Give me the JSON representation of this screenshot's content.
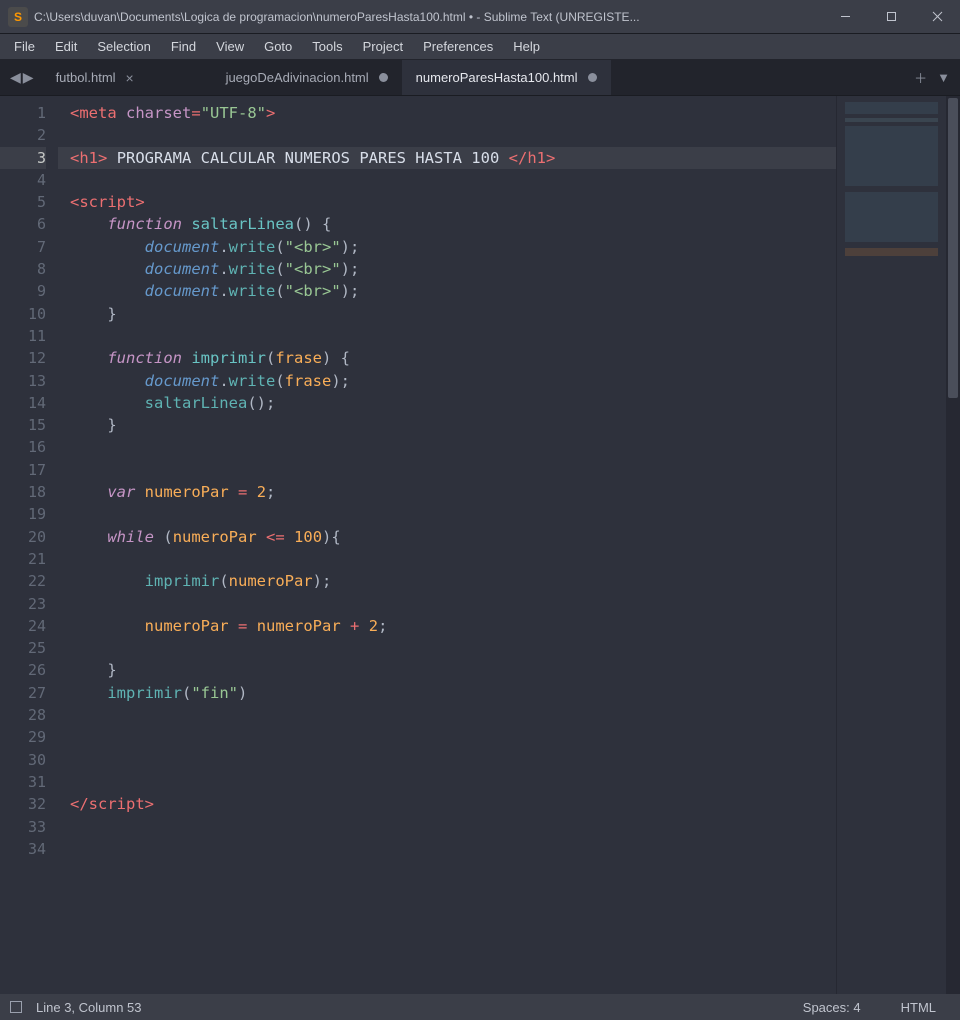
{
  "titlebar": {
    "app_initial": "S",
    "title": "C:\\Users\\duvan\\Documents\\Logica de programacion\\numeroParesHasta100.html • - Sublime Text (UNREGISTE..."
  },
  "menu": [
    "File",
    "Edit",
    "Selection",
    "Find",
    "View",
    "Goto",
    "Tools",
    "Project",
    "Preferences",
    "Help"
  ],
  "tabs": [
    {
      "label": "futbol.html",
      "dirty": false,
      "active": false,
      "closeable": true
    },
    {
      "label": "juegoDeAdivinacion.html",
      "dirty": true,
      "active": false,
      "closeable": false
    },
    {
      "label": "numeroParesHasta100.html",
      "dirty": true,
      "active": true,
      "closeable": false
    }
  ],
  "code": {
    "lines": [
      {
        "n": 1,
        "mod": false,
        "html": "<span class='c-tag'>&lt;</span><span class='c-tagname'>meta</span> <span class='c-attr'>charset</span><span class='c-op'>=</span><span class='c-str'>\"UTF-8\"</span><span class='c-tag'>&gt;</span>"
      },
      {
        "n": 2,
        "mod": false,
        "html": ""
      },
      {
        "n": 3,
        "mod": true,
        "cur": true,
        "html": "<span class='c-tag'>&lt;</span><span class='c-tagname'>h1</span><span class='c-tag'>&gt;</span><span class='c-text'> PROGRAMA CALCULAR NUMEROS PARES HASTA 100 </span><span class='c-tag'>&lt;/</span><span class='c-tagname'>h1</span><span class='c-tag'>&gt;</span>"
      },
      {
        "n": 4,
        "mod": false,
        "html": ""
      },
      {
        "n": 5,
        "mod": false,
        "html": "<span class='c-tag'>&lt;</span><span class='c-tagname'>script</span><span class='c-tag'>&gt;</span>"
      },
      {
        "n": 6,
        "mod": false,
        "html": "    <span class='c-storage'>function</span> <span class='c-fn'>saltarLinea</span><span class='c-punc'>() {</span>"
      },
      {
        "n": 7,
        "mod": false,
        "html": "        <span class='c-obj'>document</span><span class='c-punc'>.</span><span class='c-call'>write</span><span class='c-punc'>(</span><span class='c-str'>\"&lt;br&gt;\"</span><span class='c-punc'>);</span>"
      },
      {
        "n": 8,
        "mod": false,
        "html": "        <span class='c-obj'>document</span><span class='c-punc'>.</span><span class='c-call'>write</span><span class='c-punc'>(</span><span class='c-str'>\"&lt;br&gt;\"</span><span class='c-punc'>);</span>"
      },
      {
        "n": 9,
        "mod": false,
        "html": "        <span class='c-obj'>document</span><span class='c-punc'>.</span><span class='c-call'>write</span><span class='c-punc'>(</span><span class='c-str'>\"&lt;br&gt;\"</span><span class='c-punc'>);</span>"
      },
      {
        "n": 10,
        "mod": false,
        "html": "    <span class='c-punc'>}</span>"
      },
      {
        "n": 11,
        "mod": false,
        "html": ""
      },
      {
        "n": 12,
        "mod": false,
        "html": "    <span class='c-storage'>function</span> <span class='c-fn'>imprimir</span><span class='c-punc'>(</span><span class='c-param'>frase</span><span class='c-punc'>) {</span>"
      },
      {
        "n": 13,
        "mod": false,
        "html": "        <span class='c-obj'>document</span><span class='c-punc'>.</span><span class='c-call'>write</span><span class='c-punc'>(</span><span class='c-var'>frase</span><span class='c-punc'>);</span>"
      },
      {
        "n": 14,
        "mod": false,
        "html": "        <span class='c-call'>saltarLinea</span><span class='c-punc'>();</span>"
      },
      {
        "n": 15,
        "mod": false,
        "html": "    <span class='c-punc'>}</span>"
      },
      {
        "n": 16,
        "mod": false,
        "html": ""
      },
      {
        "n": 17,
        "mod": true,
        "html": ""
      },
      {
        "n": 18,
        "mod": true,
        "html": "    <span class='c-storage'>var</span> <span class='c-var'>numeroPar</span> <span class='c-op'>=</span> <span class='c-num'>2</span><span class='c-punc'>;</span>"
      },
      {
        "n": 19,
        "mod": true,
        "html": ""
      },
      {
        "n": 20,
        "mod": true,
        "html": "    <span class='c-kw'>while</span> <span class='c-punc'>(</span><span class='c-var'>numeroPar</span> <span class='c-op'>&lt;=</span> <span class='c-num'>100</span><span class='c-punc'>){</span>"
      },
      {
        "n": 21,
        "mod": true,
        "html": ""
      },
      {
        "n": 22,
        "mod": true,
        "html": "        <span class='c-call'>imprimir</span><span class='c-punc'>(</span><span class='c-var'>numeroPar</span><span class='c-punc'>);</span>"
      },
      {
        "n": 23,
        "mod": true,
        "html": ""
      },
      {
        "n": 24,
        "mod": true,
        "html": "        <span class='c-var'>numeroPar</span> <span class='c-op'>=</span> <span class='c-var'>numeroPar</span> <span class='c-op'>+</span> <span class='c-num'>2</span><span class='c-punc'>;</span>"
      },
      {
        "n": 25,
        "mod": true,
        "html": ""
      },
      {
        "n": 26,
        "mod": true,
        "html": "    <span class='c-punc'>}</span>"
      },
      {
        "n": 27,
        "mod": true,
        "html": "    <span class='c-call'>imprimir</span><span class='c-punc'>(</span><span class='c-str'>\"fin\"</span><span class='c-punc'>)</span>"
      },
      {
        "n": 28,
        "mod": true,
        "html": ""
      },
      {
        "n": 29,
        "mod": false,
        "html": ""
      },
      {
        "n": 30,
        "mod": false,
        "html": ""
      },
      {
        "n": 31,
        "mod": false,
        "html": ""
      },
      {
        "n": 32,
        "mod": false,
        "html": "<span class='c-tag'>&lt;/</span><span class='c-tagname'>script</span><span class='c-tag'>&gt;</span>"
      },
      {
        "n": 33,
        "mod": false,
        "html": ""
      },
      {
        "n": 34,
        "mod": false,
        "html": ""
      }
    ]
  },
  "status": {
    "position": "Line 3, Column 53",
    "spaces": "Spaces: 4",
    "syntax": "HTML"
  }
}
